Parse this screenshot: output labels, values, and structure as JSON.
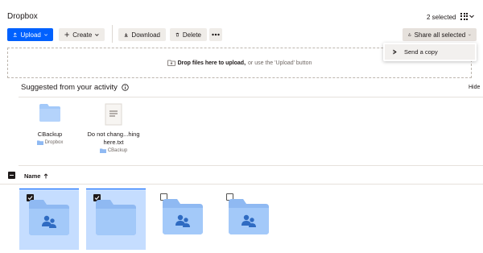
{
  "app": {
    "title": "Dropbox"
  },
  "header": {
    "selected_count": "2 selected",
    "grid_icon": "grid-view-icon"
  },
  "toolbar": {
    "upload_label": "Upload",
    "create_label": "Create",
    "download_label": "Download",
    "delete_label": "Delete",
    "share_all_label": "Share all selected"
  },
  "dropzone": {
    "bold_text": "Drop files here to upload,",
    "rest_text": "or use the 'Upload' button"
  },
  "share_menu": {
    "items": [
      {
        "label": "Send a copy",
        "icon": "send-copy-icon"
      }
    ]
  },
  "suggested": {
    "title": "Suggested from your activity",
    "hide_label": "Hide",
    "items": [
      {
        "name_line1": "CBackup",
        "name_line2": "",
        "location": "Dropbox",
        "type": "folder"
      },
      {
        "name_line1": "Do not chang...hing",
        "name_line2": "here.txt",
        "location": "CBackup",
        "type": "file"
      }
    ]
  },
  "list": {
    "name_column": "Name",
    "sort_direction": "ascending",
    "tiles": [
      {
        "selected": true,
        "type": "shared-folder"
      },
      {
        "selected": true,
        "type": "folder"
      },
      {
        "selected": false,
        "type": "shared-folder"
      },
      {
        "selected": false,
        "type": "shared-folder"
      }
    ]
  },
  "colors": {
    "accent": "#0061fe",
    "folder": "#a3c9f9",
    "folder_tab": "#8fb9f2",
    "selected_bg": "#c5ddff"
  }
}
